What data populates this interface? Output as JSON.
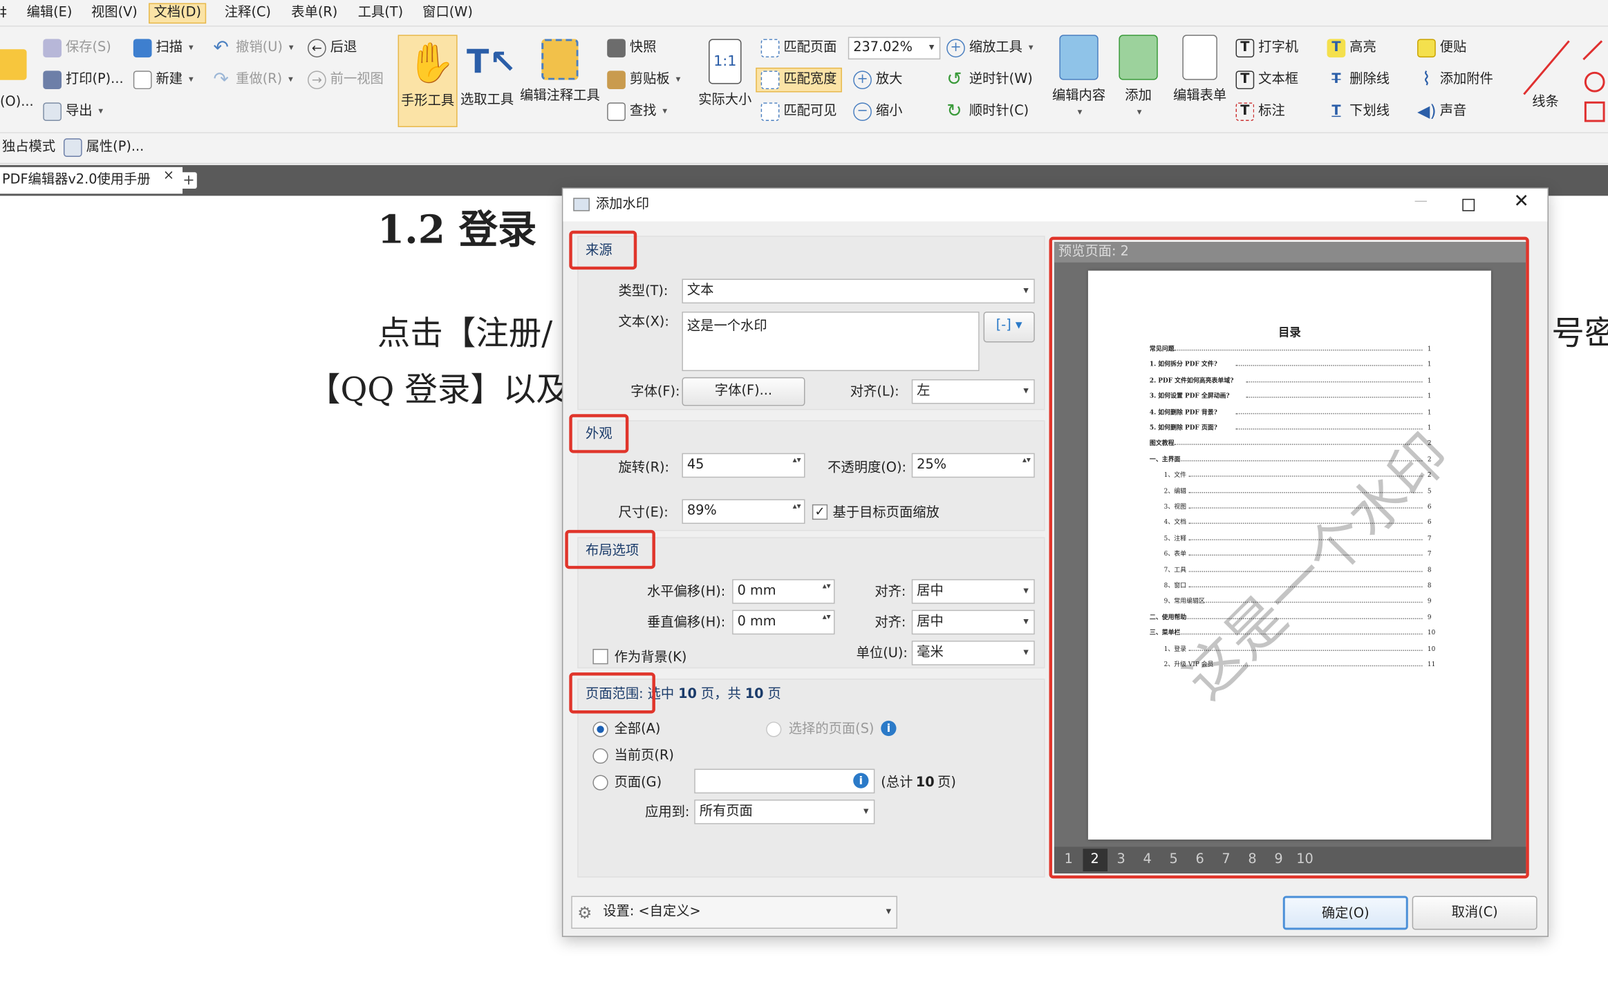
{
  "menubar": {
    "items": [
      "编辑(E)",
      "视图(V)",
      "文档(D)",
      "注释(C)",
      "表单(R)",
      "工具(T)",
      "窗口(W)"
    ],
    "active": "文档(D)"
  },
  "ribbon": {
    "open_label": "(O)...",
    "save": "保存(S)",
    "print": "打印(P)...",
    "export": "导出",
    "scan": "扫描",
    "new": "新建",
    "undo": "撤销(U)",
    "redo": "重做(R)",
    "back": "后退",
    "prev_view": "前一视图",
    "hand_tool": "手形工具",
    "select_tool": "选取工具",
    "edit_annot_tool": "编辑注释工具",
    "snapshot": "快照",
    "clipboard": "剪贴板",
    "find": "查找",
    "actual_size": "实际大小",
    "fit_page": "匹配页面",
    "fit_width": "匹配宽度",
    "fit_visible": "匹配可见",
    "zoom_value": "237.02%",
    "zoom_tool": "缩放工具",
    "zoom_in": "放大",
    "zoom_out": "缩小",
    "rotate_ccw": "逆时针(W)",
    "rotate_cw": "顺时针(C)",
    "edit_content": "编辑内容",
    "add": "添加",
    "edit_form": "编辑表单",
    "typewriter": "打字机",
    "textbox": "文本框",
    "callout": "标注",
    "highlight": "高亮",
    "strikeout": "删除线",
    "underline": "下划线",
    "note": "便贴",
    "attach": "添加附件",
    "sound": "声音",
    "line": "线条",
    "exclusive_mode": "独占模式",
    "properties": "属性(P)..."
  },
  "tabs": {
    "doc_title": "PDF编辑器v2.0使用手册",
    "close": "×",
    "add": "+"
  },
  "document": {
    "heading": "1.2 登录",
    "line1_left": "点击【注册/",
    "line1_right": "号密",
    "line2": "【QQ 登录】以及"
  },
  "dialog": {
    "title": "添加水印",
    "source": {
      "header": "来源",
      "type_label": "类型(T):",
      "type_value": "文本",
      "text_label": "文本(X):",
      "text_value": "这是一个水印",
      "font_label": "字体(F):",
      "font_button": "字体(F)...",
      "align_label": "对齐(L):",
      "align_value": "左"
    },
    "appearance": {
      "header": "外观",
      "rotation_label": "旋转(R):",
      "rotation_value": "45",
      "opacity_label": "不透明度(O):",
      "opacity_value": "25%",
      "size_label": "尺寸(E):",
      "size_value": "89%",
      "scale_label": "基于目标页面缩放",
      "scale_checked": true
    },
    "layout": {
      "header": "布局选项",
      "hoffset_label": "水平偏移(H):",
      "hoffset_value": "0 mm",
      "voffset_label": "垂直偏移(H):",
      "voffset_value": "0 mm",
      "align_label": "对齐:",
      "halign_value": "居中",
      "valign_value": "居中",
      "background_label": "作为背景(K)",
      "unit_label": "单位(U):",
      "unit_value": "毫米"
    },
    "range": {
      "header": "页面范围:",
      "summary_a": "选中",
      "selected": "10",
      "summary_b": "页，共",
      "total": "10",
      "summary_c": "页",
      "all": "全部(A)",
      "current": "当前页(R)",
      "pages": "页面(G)",
      "selected_pages": "选择的页面(S)",
      "total_note_a": "(总计",
      "total_note_num": "10",
      "total_note_b": "页)",
      "apply_label": "应用到:",
      "apply_value": "所有页面"
    },
    "preview": {
      "header": "预览页面: 2",
      "watermark": "这是一个水印",
      "page_title": "目录",
      "page_numbers": [
        "1",
        "2",
        "3",
        "4",
        "5",
        "6",
        "7",
        "8",
        "9",
        "10"
      ],
      "current_page": "2",
      "toc": [
        {
          "text": "常见问题",
          "page": "1",
          "indent": 0
        },
        {
          "text": "1.  如何拆分 PDF 文件?",
          "page": "1",
          "indent": 0
        },
        {
          "text": "2.  PDF 文件如何高亮表单域?",
          "page": "1",
          "indent": 0
        },
        {
          "text": "3.  如何设置 PDF 全屏动画?",
          "page": "1",
          "indent": 0
        },
        {
          "text": "4.  如何删除 PDF 背景?",
          "page": "1",
          "indent": 0
        },
        {
          "text": "5.  如何删除 PDF 页面?",
          "page": "1",
          "indent": 0
        },
        {
          "text": "图文教程",
          "page": "2",
          "indent": 0
        },
        {
          "text": "一、主界面",
          "page": "2",
          "indent": 0
        },
        {
          "text": "1、文件",
          "page": "2",
          "indent": 1
        },
        {
          "text": "2、编辑",
          "page": "5",
          "indent": 1
        },
        {
          "text": "3、视图",
          "page": "6",
          "indent": 1
        },
        {
          "text": "4、文档",
          "page": "6",
          "indent": 1
        },
        {
          "text": "5、注释",
          "page": "7",
          "indent": 1
        },
        {
          "text": "6、表单",
          "page": "7",
          "indent": 1
        },
        {
          "text": "7、工具",
          "page": "8",
          "indent": 1
        },
        {
          "text": "8、窗口",
          "page": "8",
          "indent": 1
        },
        {
          "text": "9、常用编辑区",
          "page": "9",
          "indent": 1
        },
        {
          "text": "二、使用帮助",
          "page": "9",
          "indent": 0
        },
        {
          "text": "三、菜单栏",
          "page": "10",
          "indent": 0
        },
        {
          "text": "1、登录",
          "page": "10",
          "indent": 1
        },
        {
          "text": "2、升级 VIP 会员",
          "page": "11",
          "indent": 1
        }
      ]
    },
    "settings_label": "设置:",
    "settings_value": "<自定义>",
    "ok": "确定(O)",
    "cancel": "取消(C)"
  },
  "colors": {
    "highlight_red": "#e0352b",
    "active_tool": "#fbe3a6",
    "link_blue": "#1a3b6a"
  }
}
